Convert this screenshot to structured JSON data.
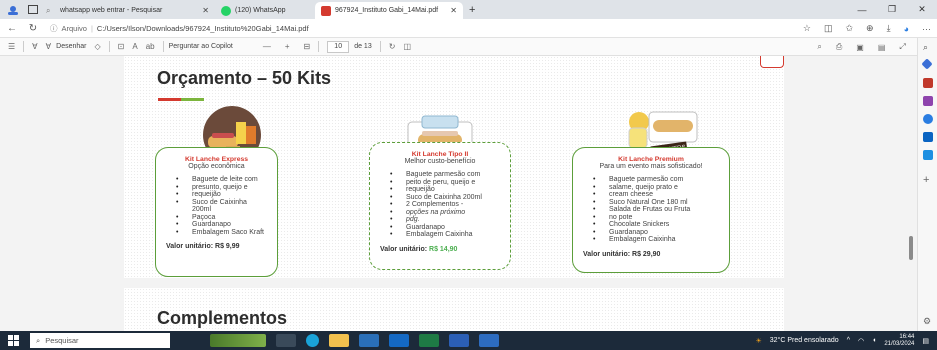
{
  "tabs": [
    {
      "label": "whatsapp web entrar - Pesquisar",
      "active": false
    },
    {
      "label": "(120) WhatsApp",
      "active": false
    },
    {
      "label": "967924_Instituto Gabi_14Mai.pdf",
      "active": true
    }
  ],
  "address": {
    "label": "Arquivo",
    "url": "C:/Users/Ilson/Downloads/967924_Instituto%20Gabi_14Mai.pdf"
  },
  "pdf_toolbar": {
    "draw_label": "Desenhar",
    "copilot_label": "Perguntar ao Copilot",
    "minus": "—",
    "plus": "+",
    "page_current": "10",
    "page_total": "de 13"
  },
  "document": {
    "title": "Orçamento – 50 Kits",
    "next_title": "Complementos",
    "cards": [
      {
        "name": "Kit Lanche Express",
        "subtitle": "Opção econômica",
        "items": [
          "Baguete de leite com",
          "presunto, queijo e",
          "requeijão",
          "Suco de Caixinha 200ml",
          "Paçoca",
          "Guardanapo",
          "Embalagem Saco Kraft"
        ],
        "price_label": "Valor unitário:",
        "price_value": "R$ 9,99"
      },
      {
        "name": "Kit Lanche Tipo II",
        "subtitle": "Melhor custo-benefício",
        "items": [
          "Baguete parmesão com",
          "peito de peru, queijo e",
          "requeijão",
          "Suco de Caixinha 200ml",
          "2 Complementos -",
          "opções na próximo",
          "pdg.",
          "Guardanapo",
          "Embalagem Caixinha"
        ],
        "price_label": "Valor unitário:",
        "price_value": "R$ 14,90"
      },
      {
        "name": "Kit Lanche Premium",
        "subtitle": "Para um evento mais sofisticado!",
        "items": [
          "Baguete parmesão com",
          "salame, queijo prato e",
          "cream cheese",
          "Suco Natural One 180 ml",
          "Salada de Frutas ou Fruta",
          "no pote",
          "Chocolate Snickers",
          "Guardanapo",
          "Embalagem Caixinha"
        ],
        "price_label": "Valor unitário:",
        "price_value": "R$ 29,90"
      }
    ]
  },
  "taskbar": {
    "search_placeholder": "Pesquisar",
    "weather": "32°C  Pred ensolarado",
    "time": "16:44",
    "date": "21/03/2024"
  },
  "colors": {
    "accent_red": "#d43a2f",
    "accent_green": "#5c9e3a",
    "price_green": "#4caf50"
  }
}
